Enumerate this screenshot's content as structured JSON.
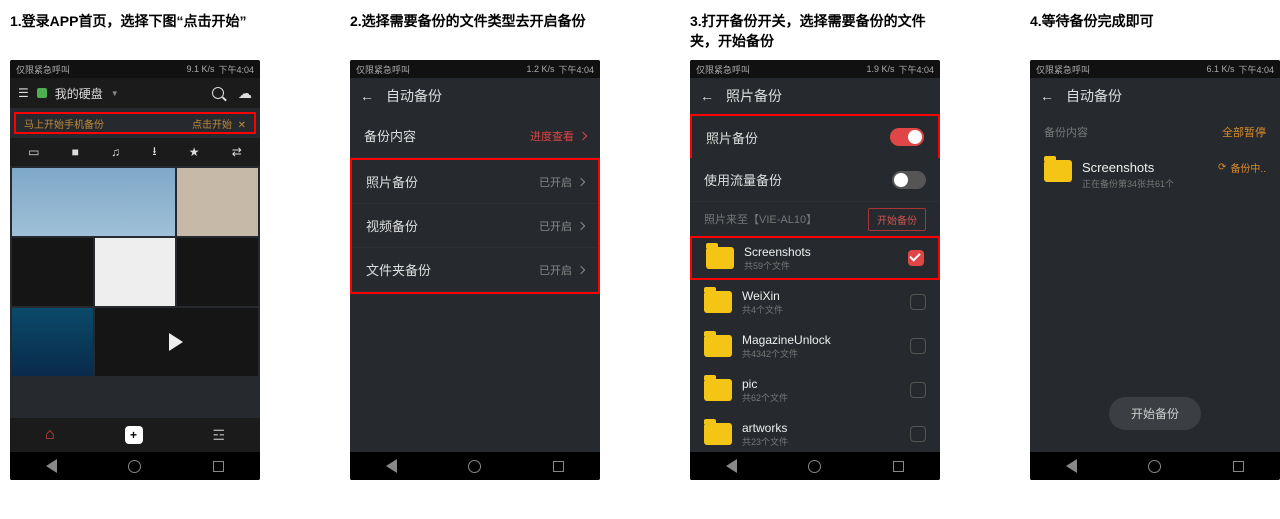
{
  "captions": {
    "c1": "1.登录APP首页，选择下图“点击开始”",
    "c2": "2.选择需要备份的文件类型去开启备份",
    "c3": "3.打开备份开关，选择需要备份的文件夹，开始备份",
    "c4": "4.等待备份完成即可"
  },
  "statusbar": {
    "left": "仅限紧急呼叫",
    "speed1": "9.1 K/s",
    "speed2": "1.2 K/s",
    "speed3": "1.9 K/s",
    "speed4": "6.1 K/s",
    "time": "下午4:04"
  },
  "screen1": {
    "title": "我的硬盘",
    "banner_left": "马上开始手机备份",
    "banner_right": "点击开始"
  },
  "screen2": {
    "title": "自动备份",
    "rows": [
      {
        "label": "备份内容",
        "value": "进度查看",
        "red": true
      },
      {
        "label": "照片备份",
        "value": "已开启"
      },
      {
        "label": "视频备份",
        "value": "已开启"
      },
      {
        "label": "文件夹备份",
        "value": "已开启"
      }
    ]
  },
  "screen3": {
    "title": "照片备份",
    "toggle1_label": "照片备份",
    "toggle2_label": "使用流量备份",
    "source_label": "照片来至【VIE-AL10】",
    "start_btn": "开始备份",
    "folders": [
      {
        "name": "Screenshots",
        "count": "共59个文件",
        "checked": true
      },
      {
        "name": "WeiXin",
        "count": "共4个文件",
        "checked": false
      },
      {
        "name": "MagazineUnlock",
        "count": "共4342个文件",
        "checked": false
      },
      {
        "name": "pic",
        "count": "共62个文件",
        "checked": false
      },
      {
        "name": "artworks",
        "count": "共23个文件",
        "checked": false
      }
    ]
  },
  "screen4": {
    "title": "自动备份",
    "row1_label": "备份内容",
    "row1_action": "全部暂停",
    "folder_name": "Screenshots",
    "folder_sub": "正在备份第34张共61个",
    "status": "备份中..",
    "button": "开始备份"
  }
}
